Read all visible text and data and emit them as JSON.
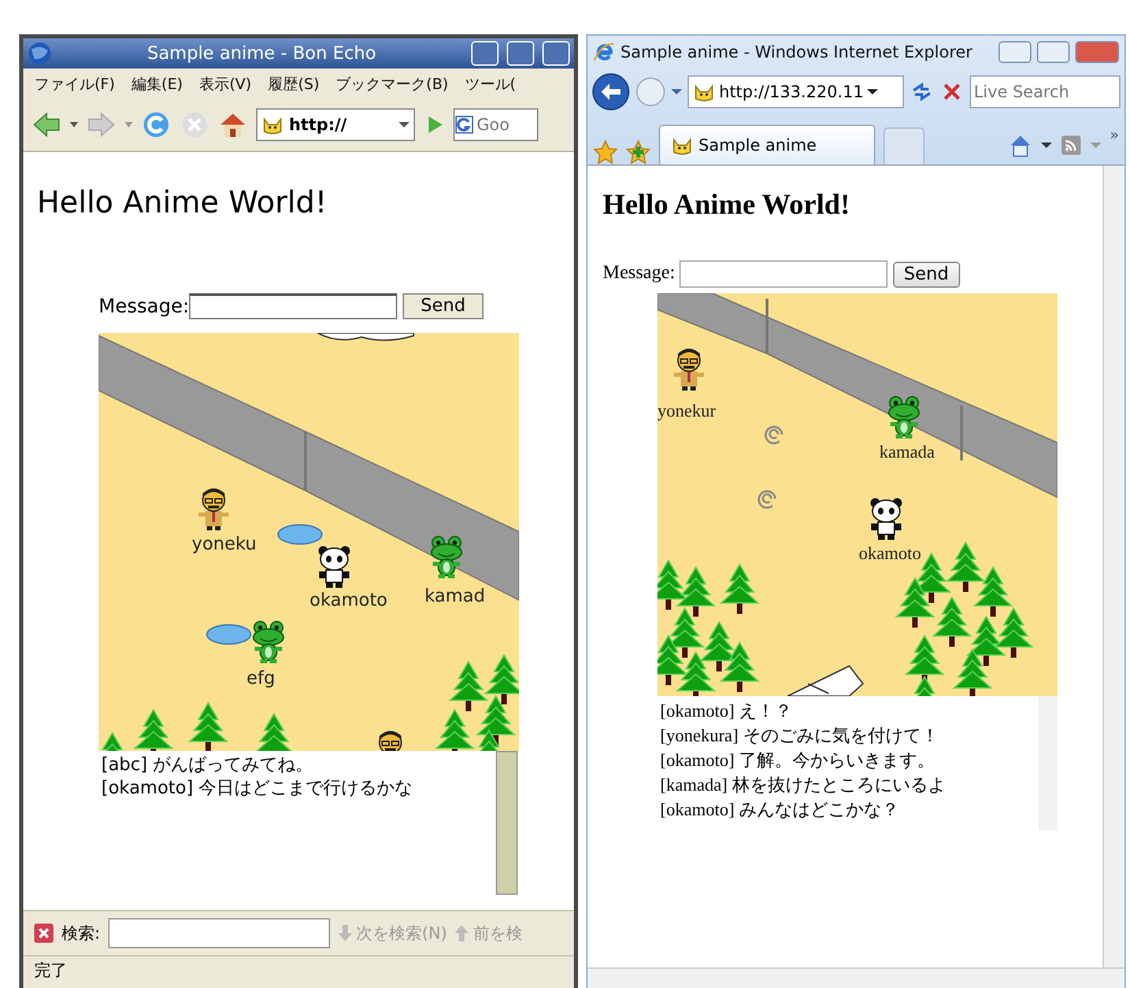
{
  "firefox": {
    "title": "Sample anime - Bon Echo",
    "menu": [
      "ファイル(F)",
      "編集(E)",
      "表示(V)",
      "履歴(S)",
      "ブックマーク(B)",
      "ツール("
    ],
    "address": "http://",
    "search_placeholder": "Goo",
    "page": {
      "heading": "Hello Anime World!",
      "message_label": "Message:",
      "send": "Send",
      "characters": [
        {
          "name": "yoneku",
          "kind": "man"
        },
        {
          "name": "okamoto",
          "kind": "panda"
        },
        {
          "name": "kamad",
          "kind": "frog"
        },
        {
          "name": "efg",
          "kind": "frog"
        }
      ],
      "chat": [
        "[abc] がんばってみてね。",
        "[okamoto] 今日はどこまで行けるかな"
      ]
    },
    "find_bar": {
      "label": "検索:",
      "next": "次を検索(N)",
      "previous": "前を検"
    },
    "status_bar": "完了"
  },
  "ie": {
    "title": "Sample anime - Windows Internet Explorer",
    "address": "http://133.220.11",
    "search_placeholder": "Live Search",
    "tabs": [
      {
        "label": "Sample anime",
        "selected": true
      }
    ],
    "overflow": "»",
    "page": {
      "heading": "Hello Anime World!",
      "message_label": "Message:",
      "send": "Send",
      "characters": [
        {
          "name": "yonekur",
          "kind": "man"
        },
        {
          "name": "kamada",
          "kind": "frog"
        },
        {
          "name": "okamoto",
          "kind": "panda"
        }
      ],
      "chat": [
        "[okamoto] え！？",
        "[yonekura] そのごみに気を付けて！",
        "[okamoto] 了解。今からいきます。",
        "[kamada] 林を抜けたところにいるよ",
        "[okamoto] みんなはどこかな？"
      ]
    }
  }
}
